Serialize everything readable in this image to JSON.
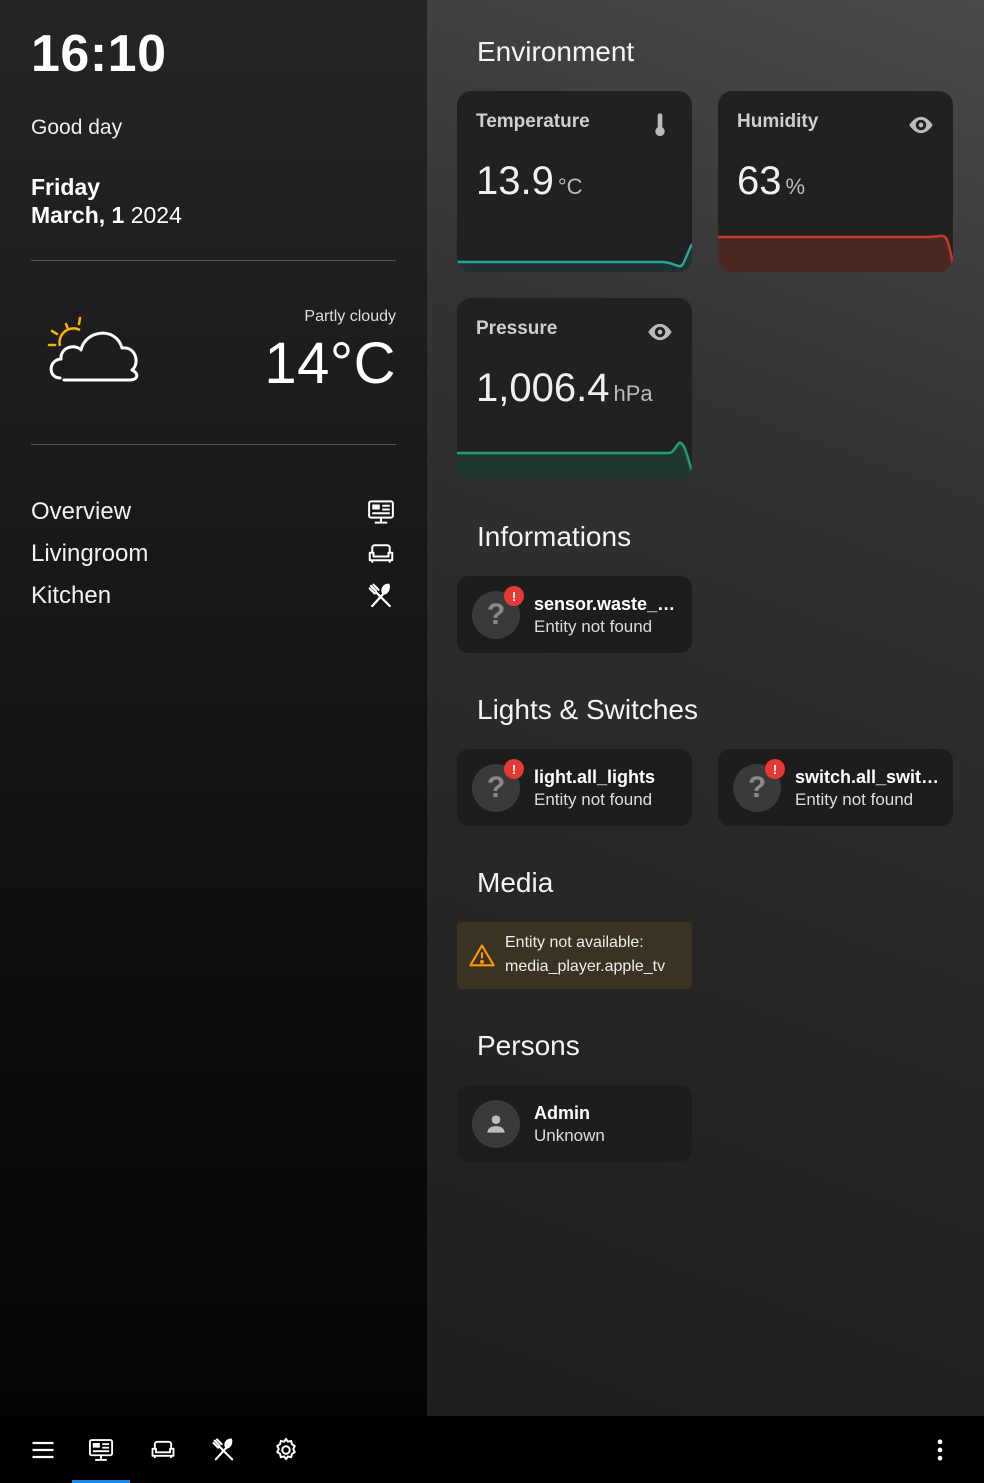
{
  "sidebar": {
    "clock": "16:10",
    "greeting": "Good day",
    "date_day": "Friday",
    "date_month_day": "March, 1",
    "date_year": " 2024",
    "weather": {
      "condition": "Partly cloudy",
      "temperature": "14°C",
      "icon": "partly-cloudy-icon"
    },
    "nav": [
      {
        "label": "Overview",
        "icon": "monitor-dashboard-icon"
      },
      {
        "label": "Livingroom",
        "icon": "sofa-icon"
      },
      {
        "label": "Kitchen",
        "icon": "silverware-icon"
      }
    ]
  },
  "main": {
    "environment": {
      "title": "Environment",
      "temperature": {
        "name": "Temperature",
        "value": "13.9",
        "unit": "°C",
        "icon": "thermometer-icon",
        "color": "#26a69a"
      },
      "humidity": {
        "name": "Humidity",
        "value": "63",
        "unit": "%",
        "icon": "eye-icon",
        "color": "#c0392b"
      },
      "pressure": {
        "name": "Pressure",
        "value": "1,006.4",
        "unit": "hPa",
        "icon": "eye-icon",
        "color": "#1e9e6e"
      }
    },
    "informations": {
      "title": "Informations",
      "entities": [
        {
          "name": "sensor.waste_…",
          "state": "Entity not found"
        }
      ]
    },
    "lights": {
      "title": "Lights & Switches",
      "entities": [
        {
          "name": "light.all_lights",
          "state": "Entity not found"
        },
        {
          "name": "switch.all_swit…",
          "state": "Entity not found"
        }
      ]
    },
    "media": {
      "title": "Media",
      "warning_line1": "Entity not available:",
      "warning_line2": "media_player.apple_tv"
    },
    "persons": {
      "title": "Persons",
      "entities": [
        {
          "name": "Admin",
          "state": "Unknown"
        }
      ]
    }
  },
  "bottombar": {
    "items": [
      "menu-icon",
      "monitor-dashboard-icon",
      "sofa-icon",
      "silverware-icon",
      "gear-icon",
      "dots-vertical-icon"
    ],
    "active": "monitor-dashboard-icon",
    "accent": "#1e88e5"
  },
  "colors": {
    "error_badge": "#e53935",
    "warning": "#ff9800"
  }
}
